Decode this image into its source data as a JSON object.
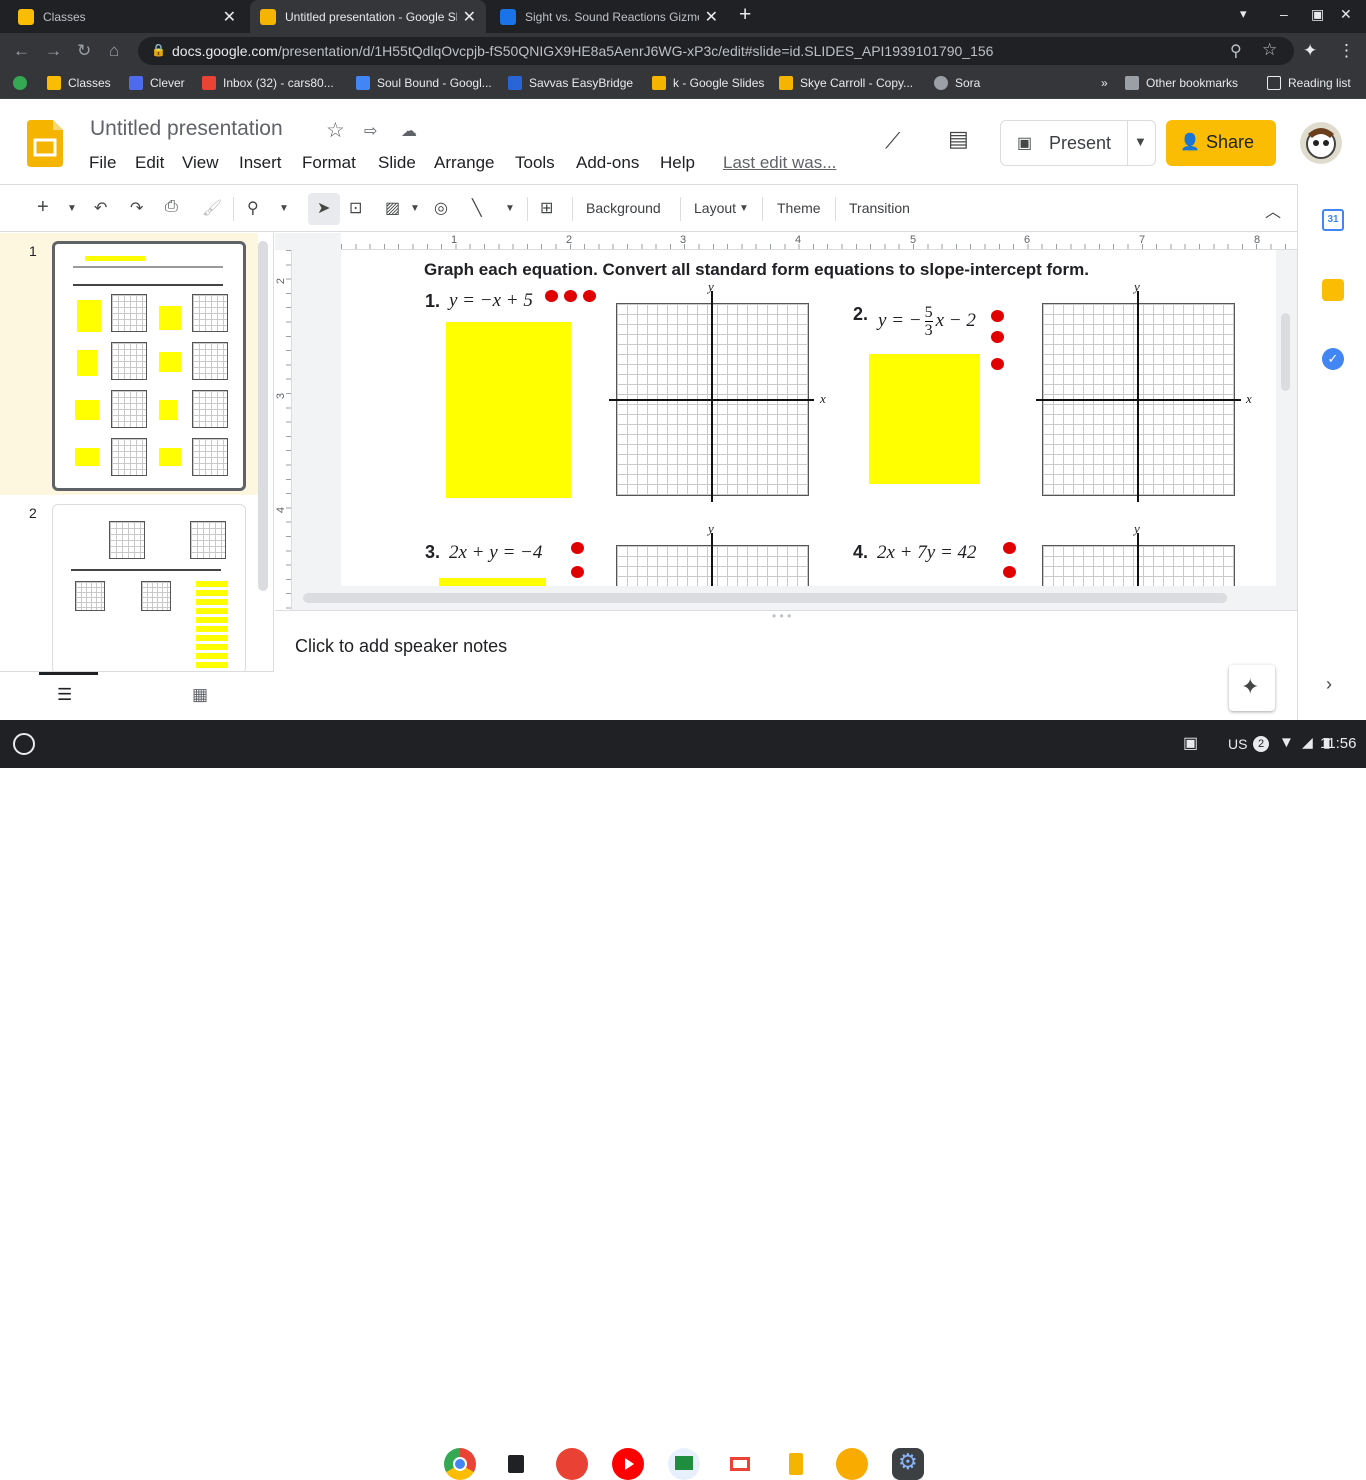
{
  "browser": {
    "tabs": [
      {
        "title": "Classes",
        "color": "#fbbc04"
      },
      {
        "title": "Untitled presentation - Google Sl",
        "color": "#f4b400"
      },
      {
        "title": "Sight vs. Sound Reactions Gizmo",
        "color": "#1a73e8"
      }
    ],
    "url_host": "docs.google.com",
    "url_path": "/presentation/d/1H55tQdlqOvcpjb-fS50QNIGX9HE8a5AenrJ6WG-xP3c/edit#slide=id.SLIDES_API1939101790_156",
    "bookmarks": [
      "Classes",
      "Clever",
      "Inbox (32) - cars80...",
      "Soul Bound - Googl...",
      "Savvas EasyBridge",
      "k - Google Slides",
      "Skye Carroll - Copy...",
      "Sora"
    ],
    "other_bookmarks": "Other bookmarks",
    "reading_list": "Reading list"
  },
  "doc": {
    "title": "Untitled presentation",
    "menus": [
      "File",
      "Edit",
      "View",
      "Insert",
      "Format",
      "Slide",
      "Arrange",
      "Tools",
      "Add-ons",
      "Help"
    ],
    "last_edit": "Last edit was...",
    "present_label": "Present",
    "share_label": "Share"
  },
  "toolbar": {
    "background": "Background",
    "layout": "Layout",
    "theme": "Theme",
    "transition": "Transition"
  },
  "ruler": {
    "h": [
      "1",
      "2",
      "3",
      "4",
      "5",
      "6",
      "7",
      "8"
    ],
    "v": [
      "2",
      "3",
      "4"
    ]
  },
  "slides_panel": {
    "numbers": [
      "1",
      "2"
    ]
  },
  "slide": {
    "instruction": "Graph each equation.  Convert all standard form equations to slope-intercept form.",
    "problems": [
      {
        "num": "1.",
        "eq": "y = −x + 5"
      },
      {
        "num": "2.",
        "eq_prefix": "y = −",
        "frac_num": "5",
        "frac_den": "3",
        "eq_suffix": "x − 2"
      },
      {
        "num": "3.",
        "eq": "2x + y = −4"
      },
      {
        "num": "4.",
        "eq": "2x + 7y = 42"
      }
    ],
    "axis_x": "x",
    "axis_y": "y"
  },
  "notes_placeholder": "Click to add speaker notes",
  "shelf": {
    "locale": "US",
    "badge": "2",
    "time": "11:56"
  }
}
